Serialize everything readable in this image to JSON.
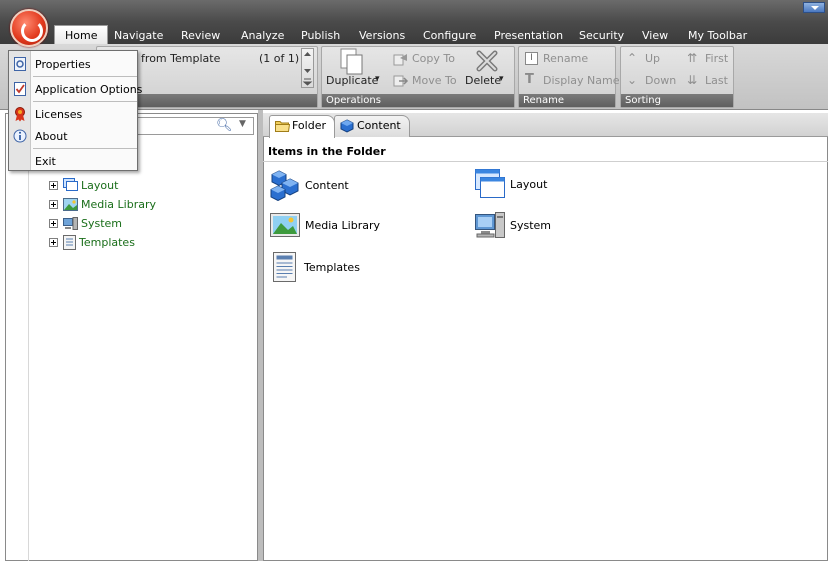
{
  "tabs": [
    "Home",
    "Navigate",
    "Review",
    "Analyze",
    "Publish",
    "Versions",
    "Configure",
    "Presentation",
    "Security",
    "View",
    "My Toolbar"
  ],
  "ribbon": {
    "insert_label": "Insert from Template",
    "pager": "(1 of 1)",
    "operations": {
      "label": "Operations",
      "duplicate": "Duplicate",
      "copy_to": "Copy To",
      "move_to": "Move To",
      "delete": "Delete"
    },
    "rename": {
      "label": "Rename",
      "rename": "Rename",
      "display_name": "Display Name"
    },
    "sorting": {
      "label": "Sorting",
      "up": "Up",
      "first": "First",
      "down": "Down",
      "last": "Last"
    }
  },
  "app_menu": {
    "items": [
      "Properties",
      "Application Options",
      "Licenses",
      "About",
      "Exit"
    ]
  },
  "tree": {
    "items": [
      "Layout",
      "Media Library",
      "System",
      "Templates"
    ]
  },
  "content_tabs": [
    "Folder",
    "Content"
  ],
  "folder_panel": {
    "title": "Items in the Folder",
    "items": [
      "Content",
      "Layout",
      "Media Library",
      "System",
      "Templates"
    ]
  },
  "colors": {
    "tree_text": "#1a6e1a",
    "tab_strip": "#4a4a4a",
    "group_label_bg": "#6b6b6b"
  }
}
